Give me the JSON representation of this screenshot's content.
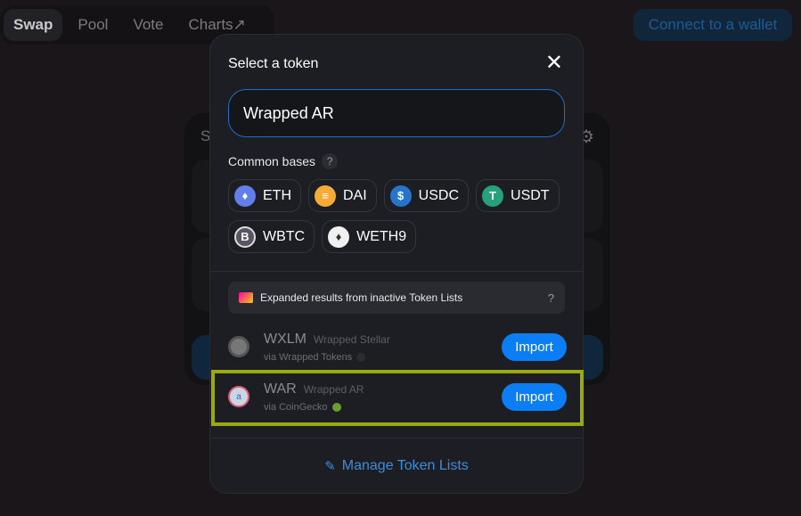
{
  "nav": {
    "tabs": [
      {
        "label": "Swap",
        "active": true
      },
      {
        "label": "Pool"
      },
      {
        "label": "Vote"
      },
      {
        "label": "Charts↗"
      }
    ],
    "connect": "Connect to a wallet"
  },
  "swap_card": {
    "title_partial": "S"
  },
  "modal": {
    "title": "Select a token",
    "search_value": "Wrapped AR",
    "common_bases_label": "Common bases",
    "help": "?",
    "bases": [
      {
        "symbol": "ETH",
        "icon": "eth-icon",
        "color": "#627eea"
      },
      {
        "symbol": "DAI",
        "icon": "dai-icon",
        "color": "#f5ac37"
      },
      {
        "symbol": "USDC",
        "icon": "usdc-icon",
        "color": "#2775ca"
      },
      {
        "symbol": "USDT",
        "icon": "usdt-icon",
        "color": "#26a17b"
      },
      {
        "symbol": "WBTC",
        "icon": "wbtc-icon",
        "color": "#5a5564"
      },
      {
        "symbol": "WETH9",
        "icon": "weth-icon",
        "color": "#f0f0f0"
      }
    ],
    "banner": "Expanded results from inactive Token Lists",
    "results": [
      {
        "symbol": "WXLM",
        "name": "Wrapped Stellar",
        "via": "via Wrapped Tokens",
        "action": "Import"
      },
      {
        "symbol": "WAR",
        "name": "Wrapped AR",
        "via": "via CoinGecko",
        "action": "Import",
        "highlighted": true
      }
    ],
    "manage": "Manage Token Lists",
    "accent": "#0b7ef5"
  }
}
